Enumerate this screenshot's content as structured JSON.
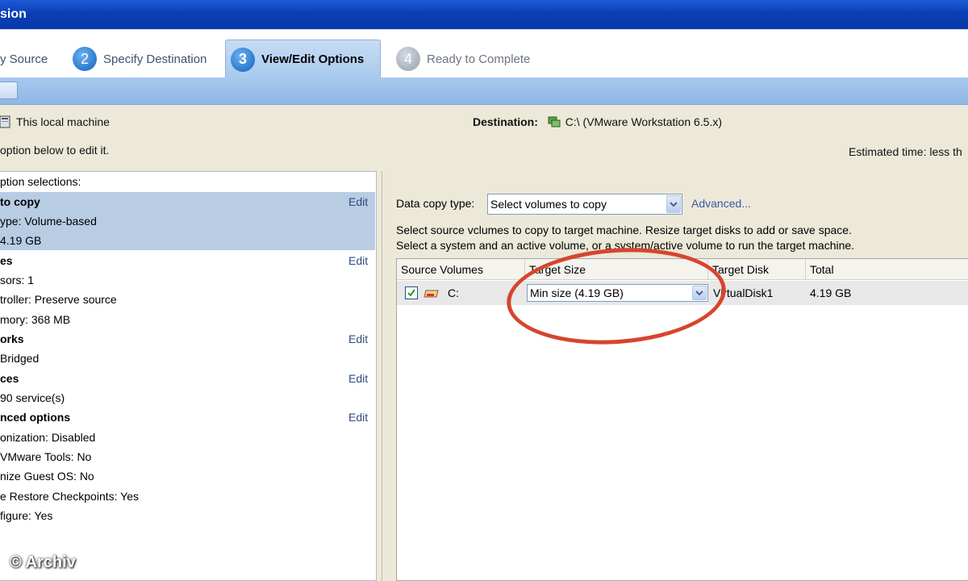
{
  "window": {
    "title": "sion"
  },
  "steps": [
    {
      "label": "y Source"
    },
    {
      "number": "2",
      "label": "Specify Destination"
    },
    {
      "number": "3",
      "label": "View/Edit Options"
    },
    {
      "number": "4",
      "label": "Ready to Complete"
    }
  ],
  "source": {
    "text": "This local machine"
  },
  "destination": {
    "label": "Destination:",
    "value": "C:\\ (VMware Workstation 6.5.x)"
  },
  "hint": "option below to edit it.",
  "estimated_time": "Estimated time:  less th",
  "left_panel": {
    "header": "ption selections:",
    "edit_label": "Edit",
    "sections": [
      {
        "title": "to copy",
        "lines": [
          "ype: Volume-based",
          "4.19 GB"
        ]
      },
      {
        "title": "es",
        "lines": [
          "sors: 1",
          "troller: Preserve source",
          "mory: 368 MB"
        ]
      },
      {
        "title": "orks",
        "lines": [
          "Bridged"
        ]
      },
      {
        "title": "ces",
        "lines": [
          "90 service(s)"
        ]
      },
      {
        "title": "nced options",
        "lines": [
          "onization: Disabled",
          "VMware Tools: No",
          "nize Guest OS: No",
          "e Restore Checkpoints: Yes",
          "figure: Yes"
        ]
      }
    ]
  },
  "watermark": "© Archiv",
  "right_panel": {
    "data_copy_label": "Data copy type:",
    "data_copy_value": "Select volumes to copy",
    "advanced_link": "Advanced...",
    "description_line1": "Select source vclumes to copy to target machine. Resize target disks to add or save space.",
    "description_line2": "Select a system and an active volume, or a system/active volume to run the target machine.",
    "table": {
      "columns": [
        "Source Volumes",
        "Target Size",
        "Target Disk",
        "Total"
      ],
      "rows": [
        {
          "checked": true,
          "volume": "C:",
          "target_size": "Min size (4.19 GB)",
          "target_disk": "VirtualDisk1",
          "total": "4.19 GB"
        }
      ]
    }
  },
  "colors": {
    "annotation_circle": "#d6452f",
    "selected_row": "#b8cce4",
    "title_bar": "#0a3fb4"
  }
}
